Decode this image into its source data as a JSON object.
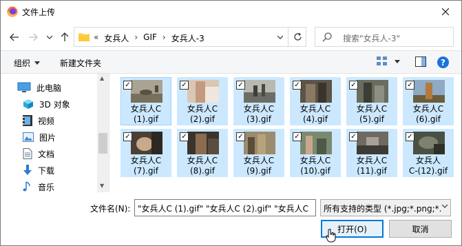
{
  "window": {
    "title": "文件上传"
  },
  "nav": {
    "breadcrumbs": [
      "«",
      "女兵人",
      "›",
      "GIF",
      "›",
      "女兵人-3"
    ],
    "search_placeholder": "搜索\"女兵人-3\""
  },
  "toolbar": {
    "organize_label": "组织",
    "new_folder_label": "新建文件夹"
  },
  "sidebar": {
    "items": [
      {
        "label": "此电脑",
        "icon": "computer-icon"
      },
      {
        "label": "3D 对象",
        "icon": "3d-objects-icon"
      },
      {
        "label": "视频",
        "icon": "video-icon"
      },
      {
        "label": "图片",
        "icon": "pictures-icon"
      },
      {
        "label": "文档",
        "icon": "documents-icon"
      },
      {
        "label": "下载",
        "icon": "download-icon"
      },
      {
        "label": "音乐",
        "icon": "music-icon"
      }
    ]
  },
  "files": [
    {
      "line1": "女兵人C",
      "line2": "(1).gif",
      "checked": true
    },
    {
      "line1": "女兵人C",
      "line2": "(2).gif",
      "checked": true
    },
    {
      "line1": "女兵人C",
      "line2": "(3).gif",
      "checked": true
    },
    {
      "line1": "女兵人C",
      "line2": "(4).gif",
      "checked": true
    },
    {
      "line1": "女兵人C",
      "line2": "(5).gif",
      "checked": true
    },
    {
      "line1": "女兵人C",
      "line2": "(6).gif",
      "checked": true
    },
    {
      "line1": "女兵人C",
      "line2": "(7).gif",
      "checked": true
    },
    {
      "line1": "女兵人C",
      "line2": "(8).gif",
      "checked": true
    },
    {
      "line1": "女兵人C",
      "line2": "(9).gif",
      "checked": true
    },
    {
      "line1": "女兵人C",
      "line2": "(10).gif",
      "checked": true
    },
    {
      "line1": "女兵人C",
      "line2": "(11).gif",
      "checked": true
    },
    {
      "line1": "女兵人",
      "line2": "C-(12).gif",
      "checked": true
    }
  ],
  "bottom": {
    "filename_label": "文件名(N):",
    "filename_value": "\"女兵人C (1).gif\" \"女兵人C (2).gif\" \"女兵人C",
    "filter_value": "所有支持的类型 (*.jpg;*.png;*.",
    "open_label": "打开(O)",
    "cancel_label": "取消"
  },
  "colors": {
    "selection": "#cce8ff",
    "accent": "#0078d7"
  }
}
